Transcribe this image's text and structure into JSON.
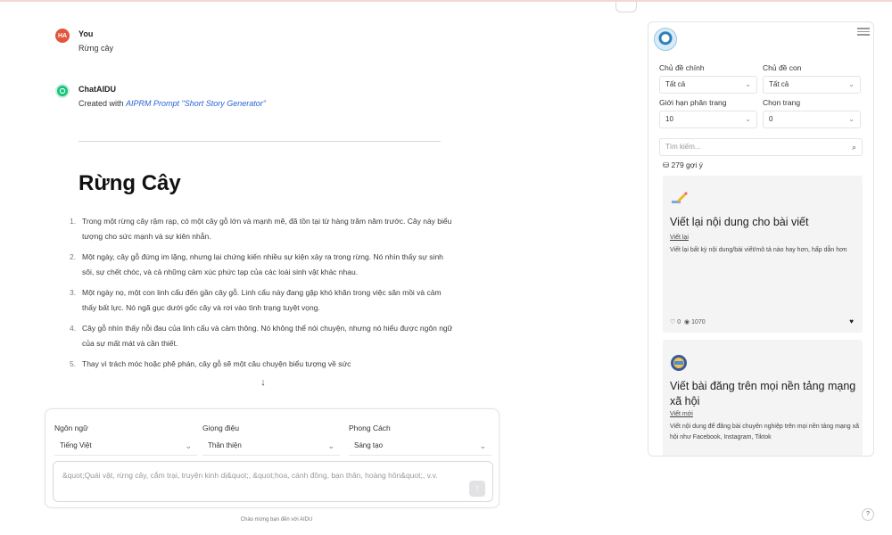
{
  "chat": {
    "user_message": {
      "avatar_text": "HA",
      "name": "You",
      "text": "Rừng cây"
    },
    "bot_message": {
      "name": "ChatAIDU",
      "created_prefix": "Created with ",
      "created_link": "AIPRM Prompt \"Short Story Generator\""
    },
    "story": {
      "title": "Rừng Cây",
      "paragraphs": [
        {
          "num": "1.",
          "text": "Trong một rừng cây rậm rạp, có một cây gỗ lớn và mạnh mẽ, đã tồn tại từ hàng trăm năm trước. Cây này biểu tượng cho sức mạnh và sự kiên nhẫn."
        },
        {
          "num": "2.",
          "text": "Một ngày, cây gỗ đứng im lặng, nhưng lại chứng kiến nhiều sự kiện xảy ra trong rừng. Nó nhìn thấy sự sinh sôi, sự chết chóc, và cả những cảm xúc phức tạp của các loài sinh vật khác nhau."
        },
        {
          "num": "3.",
          "text": "Một ngày nọ, một con linh cẩu đến gần cây gỗ. Linh cẩu này đang gặp khó khăn trong việc săn mồi và cảm thấy bất lực. Nó ngã gục dưới gốc cây và rơi vào tình trạng tuyệt vọng."
        },
        {
          "num": "4.",
          "text": "Cây gỗ nhìn thấy nỗi đau của linh cẩu và cảm thông. Nó không thể nói chuyện, nhưng nó hiểu được ngôn ngữ của sự mất mát và cần thiết."
        },
        {
          "num": "5.",
          "text": "Thay vì trách móc hoặc phê phán, cây gỗ sẽ một câu chuyện biểu tượng về sức"
        }
      ]
    }
  },
  "composer": {
    "language_label": "Ngôn ngữ",
    "language_value": "Tiếng Việt",
    "tone_label": "Giọng điệu",
    "tone_value": "Thân thiện",
    "style_label": "Phong Cách",
    "style_value": "Sáng tạo",
    "prompt_placeholder": "&quot;Quái vật, rừng cây, cắm trại, truyện kinh dị&quot;, &quot;hoa, cánh đồng, bạn thân, hoàng hôn&quot;, v.v.",
    "send_icon": "send-arrow",
    "footer": "Chào mừng bạn đến với AIDU"
  },
  "sidebar": {
    "topic_label": "Chủ đề chính",
    "topic_value": "Tất cả",
    "subtopic_label": "Chủ đề con",
    "subtopic_value": "Tất cả",
    "page_limit_label": "Giới hạn phân trang",
    "page_limit_value": "10",
    "page_select_label": "Chọn trang",
    "page_select_value": "0",
    "search_placeholder": "Tìm kiếm...",
    "count_text": "279 gợi ý",
    "cards": [
      {
        "icon": "pencil-icon",
        "title": "Viết lại nội dung cho bài viết",
        "tag": "Viết lại",
        "description": "Viết lại bất kỳ nội dung/bài viết/mô tả nào hay hơn, hấp dẫn hơn",
        "likes": "0",
        "views": "1070"
      },
      {
        "icon": "social-globe-icon",
        "title": "Viết bài đăng trên mọi nền tảng mạng xã hội",
        "tag": "Viết mới",
        "description": "Viết nội dung để đăng bài chuyên nghiệp trên mọi nền tảng mạng xã hội như Facebook, Instagram, Tiktok"
      }
    ]
  },
  "colors": {
    "user_avatar": "#e2563b",
    "bot_avatar": "#19c37d",
    "link": "#2a64d6",
    "card_bg": "#f4f4f5"
  }
}
